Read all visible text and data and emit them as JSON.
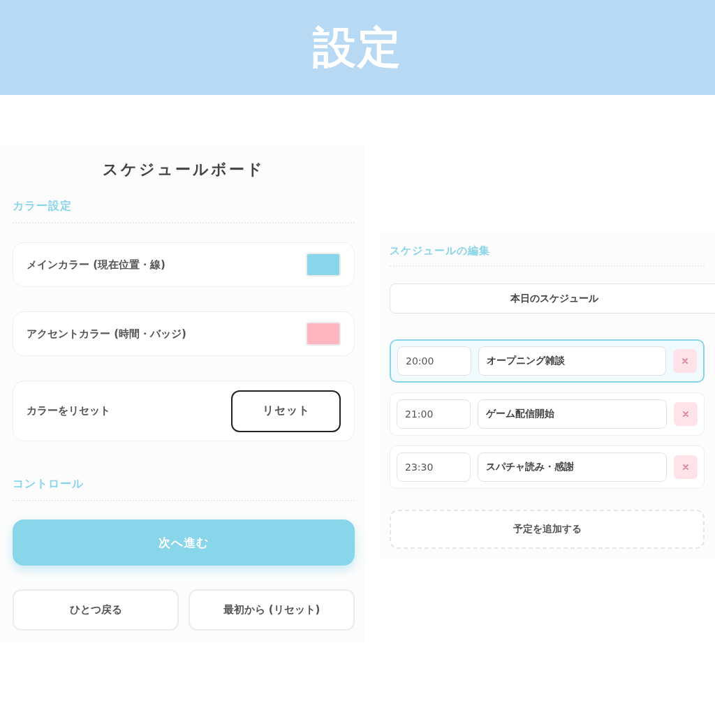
{
  "header": {
    "title": "設定"
  },
  "board": {
    "title": "スケジュールボード",
    "color_section": {
      "heading": "カラー設定",
      "rows": [
        {
          "kind": "swatch",
          "label": "メインカラー (現在位置・線)",
          "color": "#89d5ea"
        },
        {
          "kind": "swatch",
          "label": "アクセントカラー (時間・バッジ)",
          "color": "#ffb6c1"
        },
        {
          "kind": "action",
          "label": "カラーをリセット",
          "button": "リセット"
        }
      ]
    },
    "control_section": {
      "heading": "コントロール",
      "primary_button": "次へ進む",
      "buttons": [
        "ひとつ戻る",
        "最初から (リセット)"
      ]
    }
  },
  "editor": {
    "heading": "スケジュールの編集",
    "title_field": {
      "value": "本日のスケジュール"
    },
    "items": [
      {
        "time": "20:00",
        "title": "オープニング雑談",
        "selected": true
      },
      {
        "time": "21:00",
        "title": "ゲーム配信開始",
        "selected": false
      },
      {
        "time": "23:30",
        "title": "スパチャ読み・感謝",
        "selected": false
      }
    ],
    "add_button": "予定を追加する"
  }
}
